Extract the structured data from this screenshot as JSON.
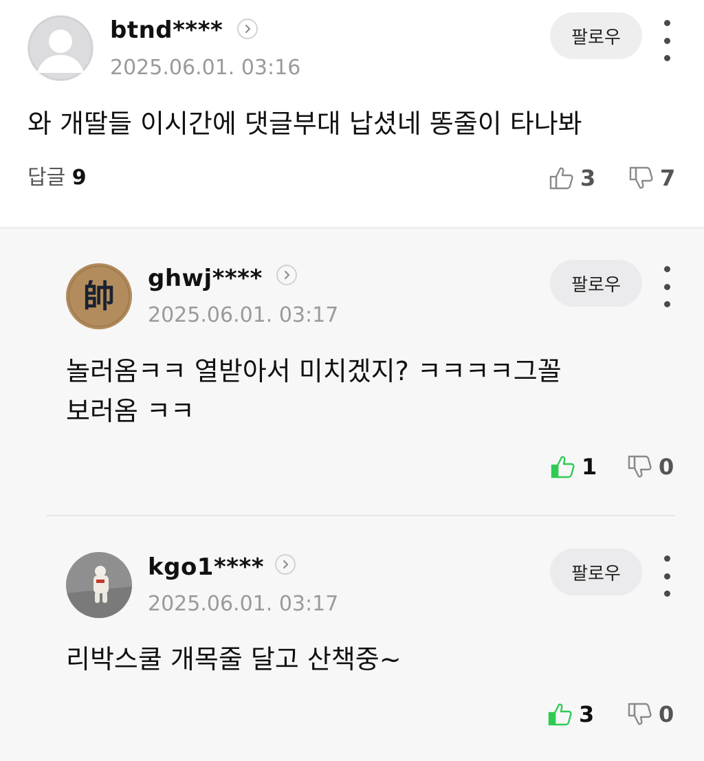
{
  "main_comment": {
    "username": "btnd****",
    "timestamp": "2025.06.01. 03:16",
    "follow_label": "팔로우",
    "text": "와 개딸들 이시간에 댓글부대 납셨네 똥줄이 타나봐",
    "reply_label": "답글",
    "reply_count": "9",
    "likes": "3",
    "dislikes": "7"
  },
  "replies": [
    {
      "username": "ghwj****",
      "timestamp": "2025.06.01. 03:17",
      "follow_label": "팔로우",
      "avatar_text": "帥",
      "text_line1": "놀러옴ㅋㅋ 열받아서 미치겠지? ㅋㅋㅋㅋ그꼴",
      "text_line2": "보러옴 ㅋㅋ",
      "likes": "1",
      "dislikes": "0"
    },
    {
      "username": "kgo1****",
      "timestamp": "2025.06.01. 03:17",
      "follow_label": "팔로우",
      "text": "리박스쿨 개목줄 달고 산책중~",
      "likes": "3",
      "dislikes": "0"
    }
  ],
  "colors": {
    "like_active": "#2fcb52",
    "icon_gray": "#8a8a8a",
    "reply_bg": "#f7f7f8"
  },
  "icons": [
    "chevron-right-icon",
    "more-vertical-icon",
    "thumbs-up-icon",
    "thumbs-down-icon",
    "default-avatar-icon"
  ]
}
